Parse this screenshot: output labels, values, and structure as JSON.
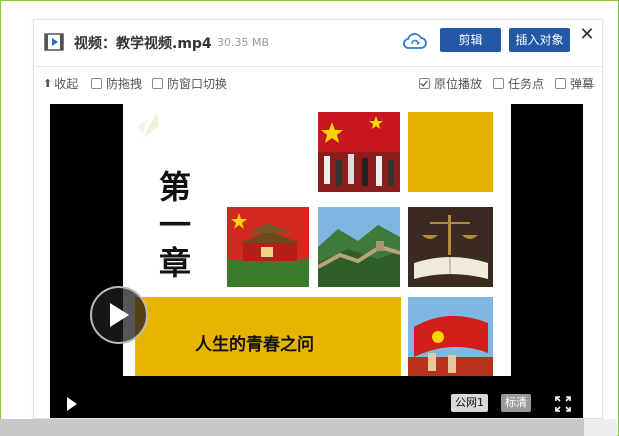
{
  "header": {
    "title": "视频：教学视频.mp4",
    "file_size": "30.35 MB",
    "edit_button": "剪辑",
    "insert_button": "插入对象",
    "close_label": "✕"
  },
  "options": {
    "collapse_label": "收起",
    "anti_drag": {
      "label": "防拖拽",
      "checked": false
    },
    "anti_switch": {
      "label": "防窗口切换",
      "checked": false
    },
    "in_place": {
      "label": "原位播放",
      "checked": true
    },
    "task_point": {
      "label": "任务点",
      "checked": false
    },
    "danmaku": {
      "label": "弹幕",
      "checked": false
    }
  },
  "slide": {
    "chapter_chars": [
      "第",
      "一",
      "章"
    ],
    "subtitle": "人生的青春之问"
  },
  "controls": {
    "line_label": "公网1",
    "quality_label": "标清"
  },
  "colors": {
    "accent_blue": "#2457a6",
    "slide_yellow": "#e9b400",
    "frame_green": "#8cc63f"
  }
}
